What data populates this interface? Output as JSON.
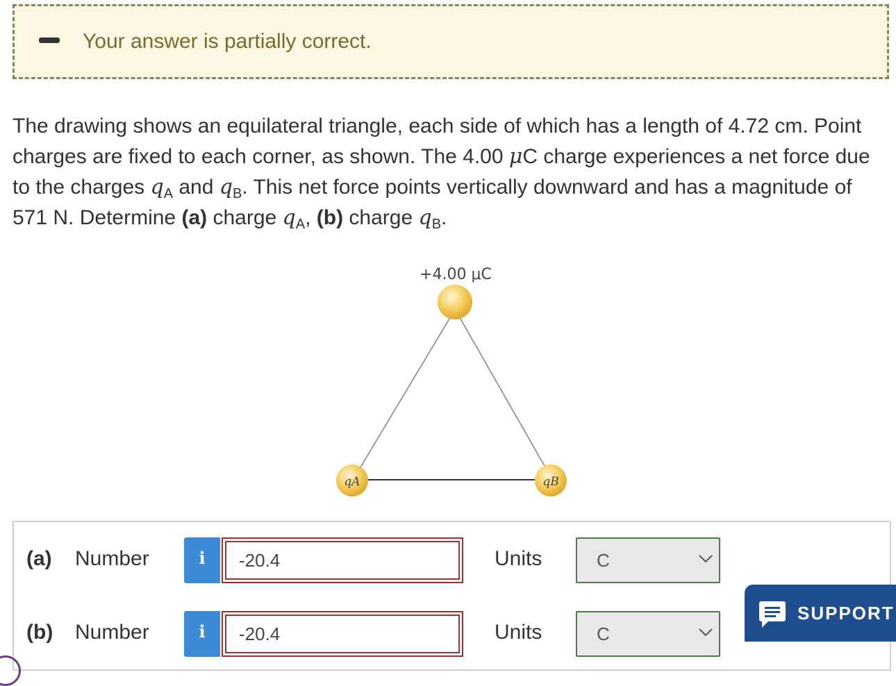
{
  "banner": {
    "message": "Your answer is partially correct."
  },
  "question": {
    "s1": "The drawing shows an equilateral triangle, each side of which has a length of 4.72 cm. Point charges are fixed to each corner, as shown. The 4.00 ",
    "mu": "μ",
    "s2": "C charge experiences a net force due to the charges ",
    "q": "q",
    "subA": "A",
    "and": " and ",
    "subB": "B",
    "s3": ". This net force points vertically downward and has a magnitude of 571 N. Determine ",
    "pa": "(a)",
    "s4": " charge ",
    "comma": ", ",
    "pb": "(b)",
    "s5": " charge ",
    "end": "."
  },
  "figure": {
    "top_label": "+4.00 μC",
    "qa_label": "qA",
    "qb_label": "qB",
    "charge_color": "#f6cf63"
  },
  "answers": {
    "rows": [
      {
        "part": "(a)",
        "label": "Number",
        "info": "i",
        "value": "-20.4",
        "units_label": "Units",
        "unit": "C"
      },
      {
        "part": "(b)",
        "label": "Number",
        "info": "i",
        "value": "-20.4",
        "units_label": "Units",
        "unit": "C"
      }
    ]
  },
  "support": {
    "label": "SUPPORT"
  },
  "colors": {
    "banner_bg": "#fbf7e3",
    "info_blue": "#3d8bd6",
    "incorrect_red": "#a0302e",
    "support_navy": "#1e4e8f",
    "select_green": "#4d7a4a"
  }
}
